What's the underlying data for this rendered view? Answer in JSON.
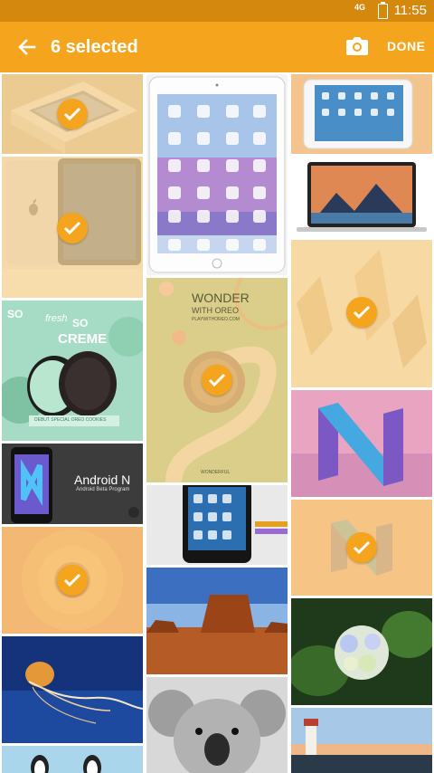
{
  "statusbar": {
    "time": "11:55",
    "signal": "4G"
  },
  "toolbar": {
    "title": "6 selected",
    "done_label": "DONE"
  },
  "tiles": {
    "oreo_promo": {
      "line1": "SO",
      "line2": "SO",
      "script": "fresh",
      "big": "CREME",
      "footer": "DEBUT SPECIAL OREO COOKIES"
    },
    "oreo_wonder": {
      "line1": "WONDER",
      "line2": "WITH OREO",
      "line3": "PLAYWITHOREO.COM",
      "footer": "WONDERFUL"
    },
    "android_n": {
      "title": "Android N",
      "subtitle": "Android Beta Program"
    }
  },
  "colors": {
    "accent": "#f5a51d",
    "statusbar": "#d4880e",
    "selected_tint": "#f8d496"
  }
}
